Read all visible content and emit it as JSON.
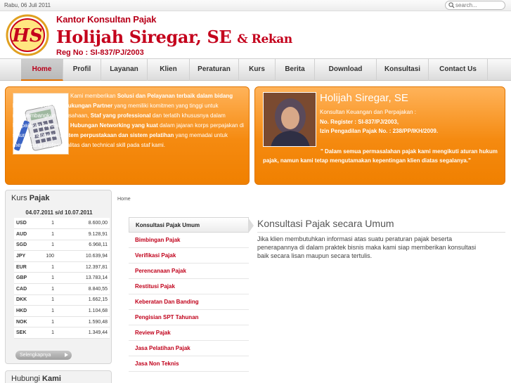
{
  "topbar": {
    "date": "Rabu, 06 Juli 2011",
    "search_placeholder": "search..."
  },
  "header": {
    "logo_text": "HS",
    "subtitle": "Kantor Konsultan Pajak",
    "name": "Holijah Siregar, SE",
    "rekan": "& Rekan",
    "reg": "Reg No : SI-837/PJ/2003"
  },
  "nav": {
    "items": [
      {
        "label": "Home",
        "active": true
      },
      {
        "label": "Profil"
      },
      {
        "label": "Layanan"
      },
      {
        "label": "Klien"
      },
      {
        "label": "Peraturan"
      },
      {
        "label": "Kurs"
      },
      {
        "label": "Berita"
      },
      {
        "label": "Download"
      },
      {
        "label": "Konsultasi"
      },
      {
        "label": "Contact Us"
      }
    ]
  },
  "intro": {
    "t1": "Kami memberikan ",
    "b1": "Solusi dan Pelayanan terbaik dalam bidang Perpajakan",
    "t2": " dengan ",
    "b2": "dukungan Partner",
    "t3": " yang memiliki komitmen yang tinggi untuk mengembangkan perusahaan, ",
    "b3": "Staf yang professional",
    "t4": " dan terlatih khususnya dalam Perpajakan Indonesia, ",
    "b4": "Hubungan Networking yang kuat",
    "t5": " dalam jajaran korps perpajakan di seluruh Indonesia, ",
    "b5": "Sistem perpustakaan dan sistem pelatihan",
    "t6": " yang memadai untuk mendukung profesionalitas dan technical skill pada staf kami."
  },
  "profile": {
    "name": "Holijah Siregar, SE",
    "role": "Konsultan Keuangan dan Perpajakan :",
    "reg": "No. Register : SI-837/PJ/2003,",
    "izin": "Izin Pengadilan Pajak No. : 238/PP/IKH/2009.",
    "quote": "\" Dalam semua permasalahan pajak kami mengikuti aturan hukum pajak, namun kami tetap mengutamakan kepentingan klien diatas segalanya.\""
  },
  "kurs": {
    "title_a": "Kurs ",
    "title_b": "Pajak",
    "period": "04.07.2011 s/d 10.07.2011",
    "more": "Selengkapnya",
    "rows": [
      {
        "code": "USD",
        "unit": "1",
        "value": "8.600,00"
      },
      {
        "code": "AUD",
        "unit": "1",
        "value": "9.128,91"
      },
      {
        "code": "SGD",
        "unit": "1",
        "value": "6.968,11"
      },
      {
        "code": "JPY",
        "unit": "100",
        "value": "10.639,94"
      },
      {
        "code": "EUR",
        "unit": "1",
        "value": "12.397,81"
      },
      {
        "code": "GBP",
        "unit": "1",
        "value": "13.783,14"
      },
      {
        "code": "CAD",
        "unit": "1",
        "value": "8.840,55"
      },
      {
        "code": "DKK",
        "unit": "1",
        "value": "1.662,15"
      },
      {
        "code": "HKD",
        "unit": "1",
        "value": "1.104,68"
      },
      {
        "code": "NOK",
        "unit": "1",
        "value": "1.590,48"
      },
      {
        "code": "SEK",
        "unit": "1",
        "value": "1.349,44"
      }
    ]
  },
  "hubungi": {
    "title_a": "Hubungi ",
    "title_b": "Kami"
  },
  "breadcrumb": "Home",
  "submenu": [
    {
      "label": "Konsultasi Pajak Umum",
      "active": true
    },
    {
      "label": "Bimbingan Pajak"
    },
    {
      "label": "Verifikasi Pajak"
    },
    {
      "label": "Perencanaan Pajak"
    },
    {
      "label": "Restitusi Pajak"
    },
    {
      "label": "Keberatan Dan Banding"
    },
    {
      "label": "Pengisian SPT Tahunan"
    },
    {
      "label": "Review Pajak"
    },
    {
      "label": "Jasa Pelatihan Pajak"
    },
    {
      "label": "Jasa Non Teknis"
    }
  ],
  "content": {
    "title": "Konsultasi Pajak secara Umum",
    "text": "Jika klien membutuhkan informasi atas suatu peraturan pajak beserta penerapannya di dalam praktek bisnis maka kami siap memberikan konsultasi baik secara lisan maupun secara tertulis."
  },
  "colors": {
    "accent": "#f58a10",
    "brand": "#c4001c"
  },
  "icons": [
    "search-icon",
    "logo-icon",
    "calculator-icon",
    "arrow-right-icon"
  ]
}
